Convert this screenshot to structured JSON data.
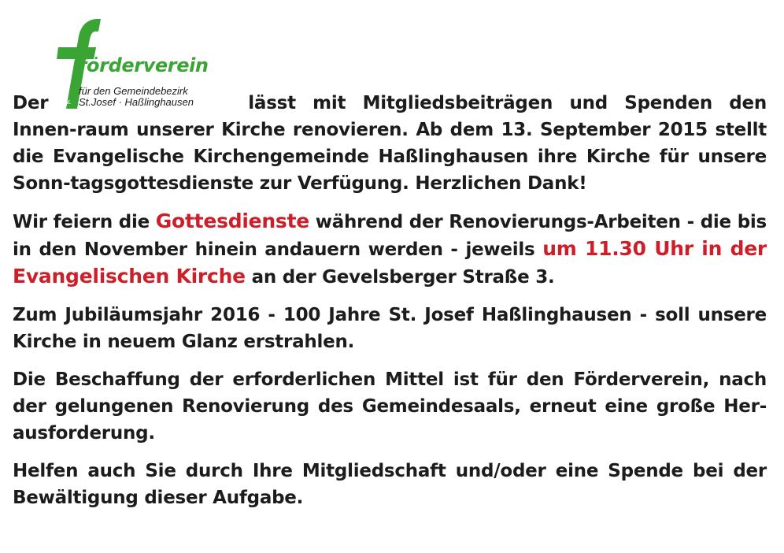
{
  "logo": {
    "wordmark": "förderverein",
    "subline1": "für den Gemeindebezirk",
    "subline2": "St.Josef · Haßlinghausen",
    "badge": "e.V.",
    "color": "#3aa535"
  },
  "accent_color": "#cc1f2a",
  "paragraphs": {
    "p1": {
      "a": "Der",
      "b": "lässt mit Mitgliedsbeiträgen und Spenden den Innen-raum unserer Kirche renovieren. Ab dem 13. September 2015 stellt die Evangelische Kirchengemeinde Haßlinghausen ihre Kirche für unsere Sonn-tagsgottesdienste zur Verfügung. Herzlichen Dank!"
    },
    "p2": {
      "a": "Wir feiern die",
      "hl1": "Gottesdienste",
      "b": "während der Renovierungs-Arbeiten - die bis in den November hinein andauern werden - jeweils",
      "hl2": "um 11.30 Uhr in der Evangelischen Kirche",
      "c": "an der Gevelsberger Straße 3."
    },
    "p3": "Zum Jubiläumsjahr 2016 - 100 Jahre St. Josef Haßlinghausen - soll unsere Kirche in neuem Glanz erstrahlen.",
    "p4": "Die Beschaffung der erforderlichen Mittel ist für den Förderverein, nach der gelungenen Renovierung des Gemeindesaals, erneut eine große Her-ausforderung.",
    "p5": "Helfen auch Sie durch Ihre Mitgliedschaft und/oder eine Spende bei der Bewältigung dieser Aufgabe."
  }
}
